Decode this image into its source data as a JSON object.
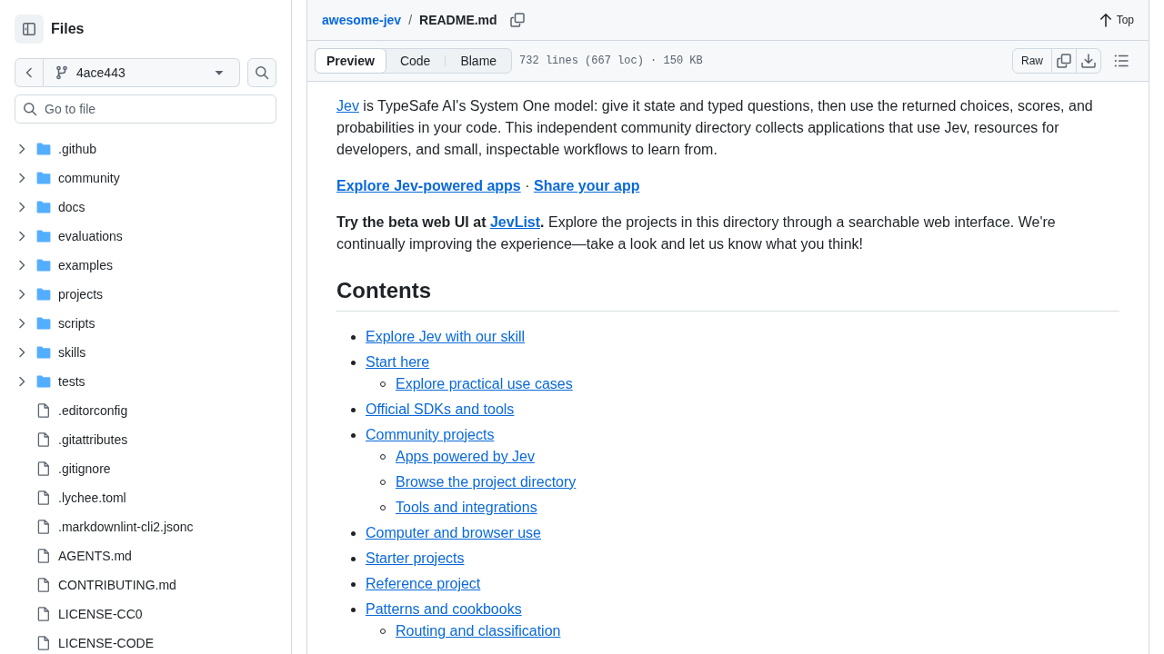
{
  "sidebar": {
    "title": "Files",
    "branch": "4ace443",
    "file_search": {
      "placeholder": "Go to file"
    },
    "tree": [
      {
        "kind": "folder",
        "name": ".github",
        "expanded": false
      },
      {
        "kind": "folder",
        "name": "community",
        "expanded": false
      },
      {
        "kind": "folder",
        "name": "docs",
        "expanded": false
      },
      {
        "kind": "folder",
        "name": "evaluations",
        "expanded": false
      },
      {
        "kind": "folder",
        "name": "examples",
        "expanded": false
      },
      {
        "kind": "folder",
        "name": "projects",
        "expanded": false
      },
      {
        "kind": "folder",
        "name": "scripts",
        "expanded": false
      },
      {
        "kind": "folder",
        "name": "skills",
        "expanded": false
      },
      {
        "kind": "folder",
        "name": "tests",
        "expanded": false
      },
      {
        "kind": "file",
        "name": ".editorconfig"
      },
      {
        "kind": "file",
        "name": ".gitattributes"
      },
      {
        "kind": "file",
        "name": ".gitignore"
      },
      {
        "kind": "file",
        "name": ".lychee.toml"
      },
      {
        "kind": "file",
        "name": ".markdownlint-cli2.jsonc"
      },
      {
        "kind": "file",
        "name": "AGENTS.md"
      },
      {
        "kind": "file",
        "name": "CONTRIBUTING.md"
      },
      {
        "kind": "file",
        "name": "LICENSE-CC0"
      },
      {
        "kind": "file",
        "name": "LICENSE-CODE"
      }
    ]
  },
  "file_header": {
    "repo_link": "awesome-jev",
    "separator": "/",
    "file_name": "README.md",
    "top_link": "Top"
  },
  "toolbar": {
    "view_tabs": [
      {
        "label": "Preview",
        "selected": true
      },
      {
        "label": "Code",
        "selected": false
      },
      {
        "label": "Blame",
        "selected": false
      }
    ],
    "file_info": "732 lines (667 loc) · 150 KB",
    "raw_button": "Raw"
  },
  "readme": {
    "blocks": [
      {
        "kind": "paragraph",
        "parts": [
          {
            "kind": "link",
            "text": "Jev"
          },
          {
            "kind": "text",
            "text": " is TypeSafe AI's System One model: give it state and typed questions, then use the returned choices, scores, and probabilities in your code. This independent community directory collects applications that use Jev, resources for developers, and small, inspectable workflows to learn from."
          }
        ]
      },
      {
        "kind": "paragraph",
        "parts": [
          {
            "kind": "strong_link",
            "text": "Explore Jev-powered apps"
          },
          {
            "kind": "text",
            "text": " · "
          },
          {
            "kind": "strong_link",
            "text": "Share your app"
          }
        ]
      },
      {
        "kind": "paragraph",
        "parts": [
          {
            "kind": "strong",
            "text": "Try the beta web UI at "
          },
          {
            "kind": "strong_link",
            "text": "JevList"
          },
          {
            "kind": "strong",
            "text": "."
          },
          {
            "kind": "text",
            "text": " Explore the projects in this directory through a searchable web interface. We're continually improving the experience—take a look and let us know what you think!"
          }
        ]
      },
      {
        "kind": "heading",
        "text": "Contents"
      },
      {
        "kind": "list",
        "items": [
          {
            "label": "Explore Jev with our skill"
          },
          {
            "label": "Start here",
            "children": [
              {
                "label": "Explore practical use cases"
              }
            ]
          },
          {
            "label": "Official SDKs and tools"
          },
          {
            "label": "Community projects",
            "children": [
              {
                "label": "Apps powered by Jev"
              },
              {
                "label": "Browse the project directory"
              },
              {
                "label": "Tools and integrations"
              }
            ]
          },
          {
            "label": "Computer and browser use"
          },
          {
            "label": "Starter projects"
          },
          {
            "label": "Reference project"
          },
          {
            "label": "Patterns and cookbooks",
            "children": [
              {
                "label": "Routing and classification"
              }
            ]
          }
        ]
      }
    ]
  }
}
